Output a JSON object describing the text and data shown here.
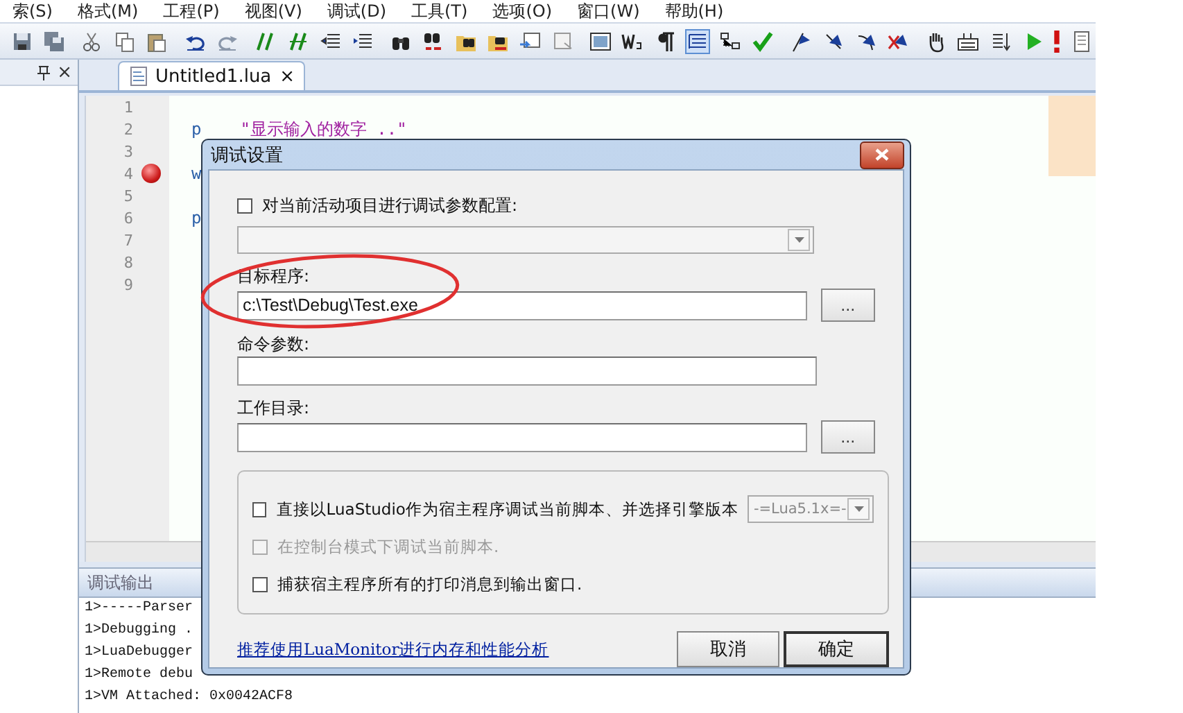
{
  "menu": [
    "索(S)",
    "格式(M)",
    "工程(P)",
    "视图(V)",
    "调试(D)",
    "工具(T)",
    "选项(O)",
    "窗口(W)",
    "帮助(H)"
  ],
  "toolbar": [
    {
      "on": false
    },
    {
      "on": false
    },
    {
      "on": false
    },
    {
      "on": false
    },
    {
      "on": false
    },
    {
      "on": false
    },
    {
      "on": false
    },
    {
      "on": false
    },
    {
      "on": false
    },
    {
      "on": false
    },
    {
      "on": false
    },
    {
      "on": false
    },
    {
      "on": false
    },
    {
      "on": false
    },
    {
      "on": false
    },
    {
      "on": false
    },
    {
      "on": false
    },
    {
      "on": false
    },
    {
      "on": false
    },
    {
      "on": false
    },
    {
      "on": true
    },
    {
      "on": false
    },
    {
      "on": false
    },
    {
      "on": false
    },
    {
      "on": false
    },
    {
      "on": false
    },
    {
      "on": false
    },
    {
      "on": false
    },
    {
      "on": false
    },
    {
      "on": false
    },
    {
      "on": false
    },
    {
      "on": false
    },
    {
      "on": false
    }
  ],
  "left_panel": {
    "close": "×"
  },
  "tab": {
    "label": "Untitled1.lua",
    "close": "×",
    "selected": true
  },
  "editor": {
    "lines": [
      {
        "number": "1",
        "breakpoint": false
      },
      {
        "number": "2",
        "breakpoint": false,
        "code": "p",
        "string": "\"显示输入的数字 ..\""
      },
      {
        "number": "3",
        "breakpoint": false
      },
      {
        "number": "4",
        "breakpoint": true,
        "code": "w"
      },
      {
        "number": "5",
        "breakpoint": false
      },
      {
        "number": "6",
        "breakpoint": false,
        "code": "p"
      },
      {
        "number": "7",
        "breakpoint": false
      },
      {
        "number": "8",
        "breakpoint": false
      },
      {
        "number": "9",
        "breakpoint": false
      }
    ]
  },
  "output": {
    "title": "调试输出",
    "lines": [
      "1>-----Parser",
      "1>Debugging .",
      "1>LuaDebugger",
      "1>Remote debu",
      "1>VM Attached: 0x0042ACF8"
    ]
  },
  "dialog": {
    "title": "调试设置",
    "project_config": {
      "label": "对当前活动项目进行调试参数配置:",
      "checked": false
    },
    "config_select": {
      "disabled": true
    },
    "fields": [
      {
        "label": "目标程序:",
        "value": "c:\\Test\\Debug\\Test.exe",
        "browse": "..."
      },
      {
        "label": "命令参数:"
      },
      {
        "label": "工作目录:",
        "browse": "..."
      }
    ],
    "options": [
      {
        "label": "直接以LuaStudio作为宿主程序调试当前脚本、并选择引擎版本",
        "checked": false,
        "disabled": false,
        "engine": "-=Lua5.1x=-"
      },
      {
        "label": "在控制台模式下调试当前脚本.",
        "checked": false,
        "disabled": true
      },
      {
        "label": "捕获宿主程序所有的打印消息到输出窗口.",
        "checked": false,
        "disabled": false
      }
    ],
    "link": "推荐使用LuaMonitor进行内存和性能分析",
    "buttons": [
      {
        "label": "取消",
        "default": false
      },
      {
        "label": "确定",
        "default": true
      }
    ]
  }
}
